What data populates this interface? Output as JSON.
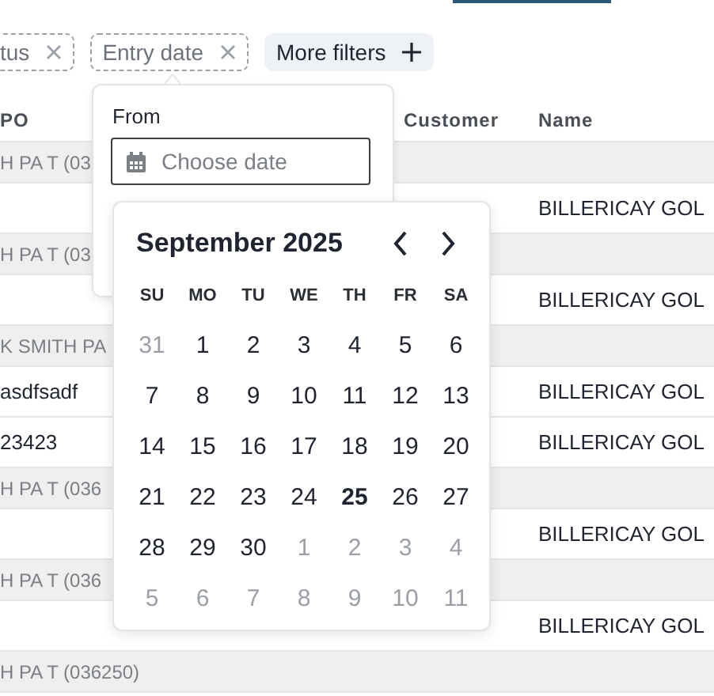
{
  "filters": [
    {
      "label": "tus",
      "removable": true
    },
    {
      "label": "Entry date",
      "removable": true
    }
  ],
  "more_filters": {
    "label": "More filters"
  },
  "table": {
    "columns": [
      "PO",
      "Customer",
      "Name"
    ],
    "rows": [
      {
        "kind": "group",
        "text": "H PA T (03"
      },
      {
        "kind": "data",
        "po": "",
        "name": "BILLERICAY GOL"
      },
      {
        "kind": "group",
        "text": "H PA T (03"
      },
      {
        "kind": "data",
        "po": "",
        "name": "BILLERICAY GOL"
      },
      {
        "kind": "group",
        "text": "K SMITH PA"
      },
      {
        "kind": "data",
        "po": "asdfsadf",
        "name": "BILLERICAY GOL"
      },
      {
        "kind": "data",
        "po": "23423",
        "name": "BILLERICAY GOL"
      },
      {
        "kind": "group",
        "text": "H PA T (036"
      },
      {
        "kind": "data",
        "po": "",
        "name": "BILLERICAY GOL"
      },
      {
        "kind": "group",
        "text": "H PA T (036"
      },
      {
        "kind": "data",
        "po": "",
        "name": "BILLERICAY GOL"
      },
      {
        "kind": "group",
        "text": "H PA T (036250)"
      }
    ]
  },
  "date_popover": {
    "label": "From",
    "placeholder": "Choose date"
  },
  "calendar": {
    "title": "September 2025",
    "weekdays": [
      "SU",
      "MO",
      "TU",
      "WE",
      "TH",
      "FR",
      "SA"
    ],
    "days": [
      {
        "day": "31",
        "outside": true,
        "today": false
      },
      {
        "day": "1",
        "outside": false,
        "today": false
      },
      {
        "day": "2",
        "outside": false,
        "today": false
      },
      {
        "day": "3",
        "outside": false,
        "today": false
      },
      {
        "day": "4",
        "outside": false,
        "today": false
      },
      {
        "day": "5",
        "outside": false,
        "today": false
      },
      {
        "day": "6",
        "outside": false,
        "today": false
      },
      {
        "day": "7",
        "outside": false,
        "today": false
      },
      {
        "day": "8",
        "outside": false,
        "today": false
      },
      {
        "day": "9",
        "outside": false,
        "today": false
      },
      {
        "day": "10",
        "outside": false,
        "today": false
      },
      {
        "day": "11",
        "outside": false,
        "today": false
      },
      {
        "day": "12",
        "outside": false,
        "today": false
      },
      {
        "day": "13",
        "outside": false,
        "today": false
      },
      {
        "day": "14",
        "outside": false,
        "today": false
      },
      {
        "day": "15",
        "outside": false,
        "today": false
      },
      {
        "day": "16",
        "outside": false,
        "today": false
      },
      {
        "day": "17",
        "outside": false,
        "today": false
      },
      {
        "day": "18",
        "outside": false,
        "today": false
      },
      {
        "day": "19",
        "outside": false,
        "today": false
      },
      {
        "day": "20",
        "outside": false,
        "today": false
      },
      {
        "day": "21",
        "outside": false,
        "today": false
      },
      {
        "day": "22",
        "outside": false,
        "today": false
      },
      {
        "day": "23",
        "outside": false,
        "today": false
      },
      {
        "day": "24",
        "outside": false,
        "today": false
      },
      {
        "day": "25",
        "outside": false,
        "today": true
      },
      {
        "day": "26",
        "outside": false,
        "today": false
      },
      {
        "day": "27",
        "outside": false,
        "today": false
      },
      {
        "day": "28",
        "outside": false,
        "today": false
      },
      {
        "day": "29",
        "outside": false,
        "today": false
      },
      {
        "day": "30",
        "outside": false,
        "today": false
      },
      {
        "day": "1",
        "outside": true,
        "today": false
      },
      {
        "day": "2",
        "outside": true,
        "today": false
      },
      {
        "day": "3",
        "outside": true,
        "today": false
      },
      {
        "day": "4",
        "outside": true,
        "today": false
      },
      {
        "day": "5",
        "outside": true,
        "today": false
      },
      {
        "day": "6",
        "outside": true,
        "today": false
      },
      {
        "day": "7",
        "outside": true,
        "today": false
      },
      {
        "day": "8",
        "outside": true,
        "today": false
      },
      {
        "day": "9",
        "outside": true,
        "today": false
      },
      {
        "day": "10",
        "outside": true,
        "today": false
      },
      {
        "day": "11",
        "outside": true,
        "today": false
      }
    ]
  }
}
